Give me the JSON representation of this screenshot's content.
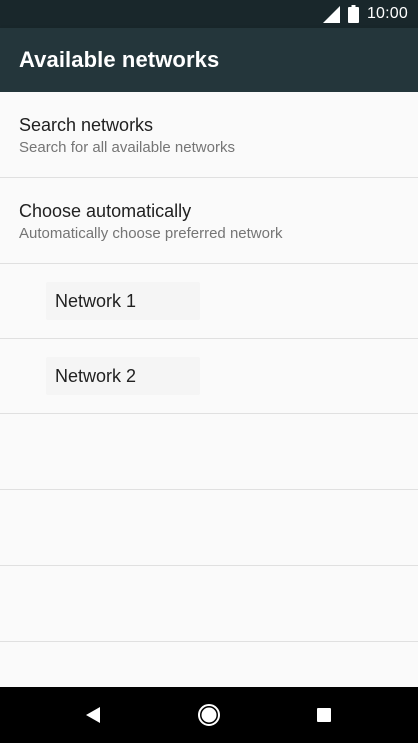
{
  "status_bar": {
    "time": "10:00",
    "icons": [
      "signal-icon",
      "battery-icon"
    ]
  },
  "app_bar": {
    "title": "Available networks"
  },
  "preferences": [
    {
      "title": "Search networks",
      "summary": "Search for all available networks"
    },
    {
      "title": "Choose automatically",
      "summary": "Automatically choose preferred network"
    }
  ],
  "networks": [
    {
      "label": "Network 1"
    },
    {
      "label": "Network 2"
    }
  ],
  "nav_bar": {
    "icons": [
      "back-icon",
      "home-icon",
      "recents-icon"
    ]
  },
  "colors": {
    "status_bar_bg": "#19272b",
    "app_bar_bg": "#24363b",
    "background": "#fafafa",
    "divider": "#e0e0e0",
    "primary_text": "#212121",
    "secondary_text": "#757575"
  }
}
